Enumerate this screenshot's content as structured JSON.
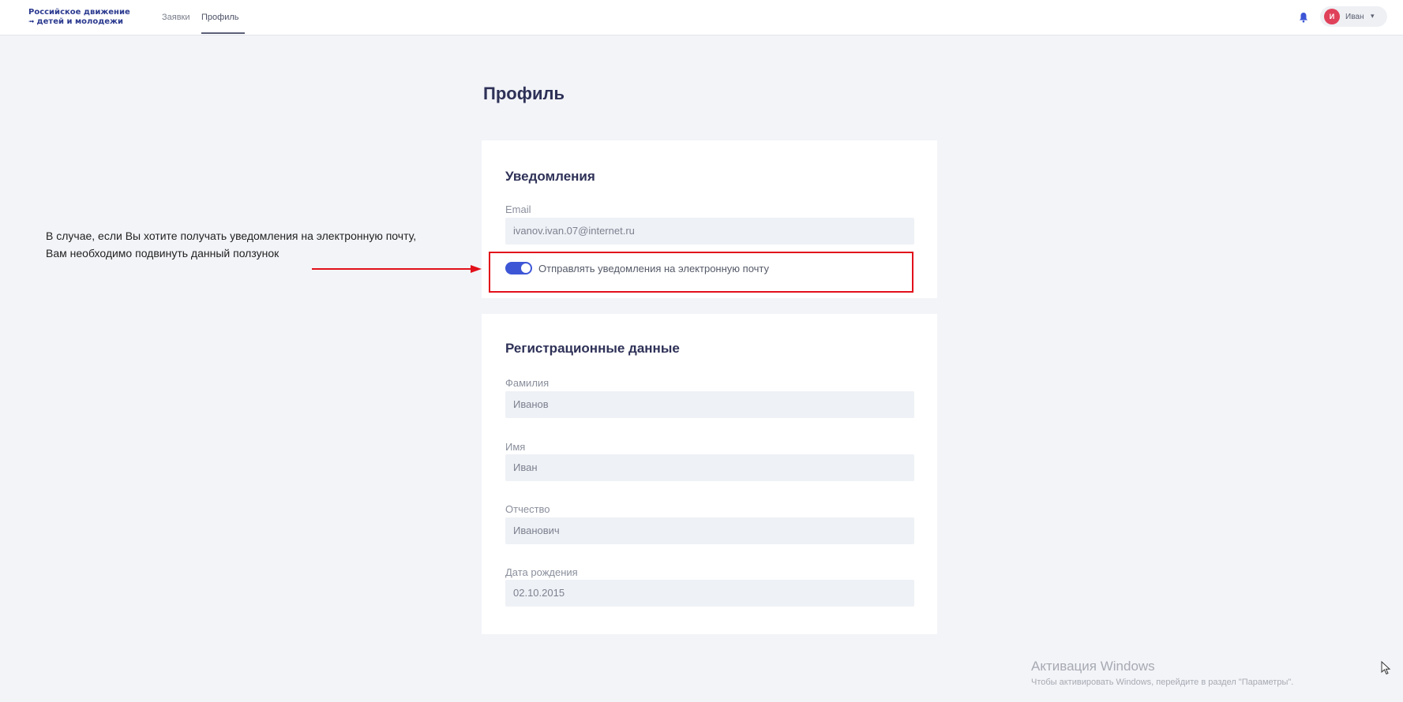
{
  "header": {
    "logo_line1": "Российское движение",
    "logo_line2": "детей и молодежи",
    "nav": [
      "Заявки",
      "Профиль"
    ],
    "user_initial": "И",
    "user_name": "Иван",
    "caret": "▾"
  },
  "page": {
    "title": "Профиль"
  },
  "notifications": {
    "title": "Уведомления",
    "email_label": "Email",
    "email_value": "ivanov.ivan.07@internet.ru",
    "toggle_label": "Отправлять уведомления на электронную почту",
    "toggle_on": true
  },
  "registration": {
    "title": "Регистрационные данные",
    "fields": [
      {
        "label": "Фамилия",
        "value": "Иванов"
      },
      {
        "label": "Имя",
        "value": "Иван"
      },
      {
        "label": "Отчество",
        "value": "Иванович"
      },
      {
        "label": "Дата рождения",
        "value": "02.10.2015"
      }
    ]
  },
  "annotation": {
    "line1": "В случае, если Вы хотите получать уведомления на электронную почту,",
    "line2": "Вам необходимо подвинуть данный ползунок",
    "color": "#e2101a"
  },
  "watermark": {
    "line1": "Активация Windows",
    "line2": "Чтобы активировать Windows, перейдите в раздел \"Параметры\"."
  },
  "colors": {
    "accent": "#3d56d6",
    "title": "#2e3157",
    "avatar": "#e0415a"
  }
}
